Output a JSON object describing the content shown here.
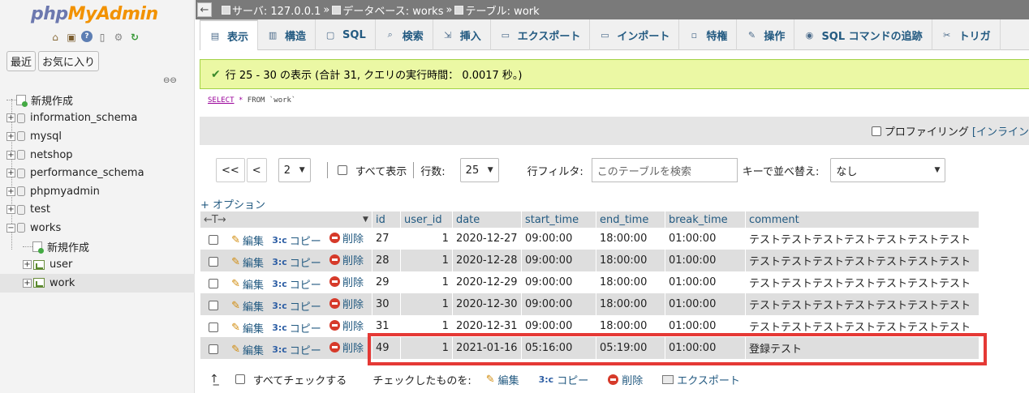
{
  "sidebar": {
    "logo_a": "php",
    "logo_b": "MyAdmin",
    "tab_recent": "最近",
    "tab_favorites": "お気に入り",
    "tree": [
      {
        "label": "新規作成",
        "kind": "new"
      },
      {
        "label": "information_schema",
        "kind": "db"
      },
      {
        "label": "mysql",
        "kind": "db"
      },
      {
        "label": "netshop",
        "kind": "db"
      },
      {
        "label": "performance_schema",
        "kind": "db"
      },
      {
        "label": "phpmyadmin",
        "kind": "db"
      },
      {
        "label": "test",
        "kind": "db"
      },
      {
        "label": "works",
        "kind": "db-open"
      },
      {
        "label": "新規作成",
        "kind": "new-child"
      },
      {
        "label": "user",
        "kind": "table"
      },
      {
        "label": "work",
        "kind": "table-selected"
      }
    ]
  },
  "breadcrumb": {
    "server": "サーバ: 127.0.0.1",
    "database": "データベース: works",
    "table": "テーブル: work",
    "sep": "»"
  },
  "tabs": [
    {
      "label": "表示",
      "icon": "browse-icon"
    },
    {
      "label": "構造",
      "icon": "structure-icon"
    },
    {
      "label": "SQL",
      "icon": "sql-icon"
    },
    {
      "label": "検索",
      "icon": "search-icon"
    },
    {
      "label": "挿入",
      "icon": "insert-icon"
    },
    {
      "label": "エクスポート",
      "icon": "export-icon"
    },
    {
      "label": "インポート",
      "icon": "import-icon"
    },
    {
      "label": "特権",
      "icon": "privileges-icon"
    },
    {
      "label": "操作",
      "icon": "wrench-icon"
    },
    {
      "label": "SQL コマンドの追跡",
      "icon": "eye-icon"
    },
    {
      "label": "トリガ",
      "icon": "trigger-icon"
    }
  ],
  "message": "行 25 - 30 の表示 (合計 31, クエリの実行時間： 0.0017 秒。)",
  "sql": {
    "select": "SELECT",
    "star": "*",
    "rest": "FROM `work`"
  },
  "profile": {
    "label": "プロファイリング",
    "inline": "[インライン"
  },
  "pager": {
    "first": "<<",
    "prev": "<",
    "page": "2",
    "show_all": "すべて表示",
    "rows_label": "行数:",
    "rows_value": "25",
    "filter_label": "行フィルタ:",
    "filter_placeholder": "このテーブルを検索",
    "sort_label": "キーで並べ替え:",
    "sort_value": "なし"
  },
  "options_label": "+ オプション",
  "table": {
    "arrows": "←T→",
    "headers": [
      "id",
      "user_id",
      "date",
      "start_time",
      "end_time",
      "break_time",
      "comment"
    ],
    "actions": {
      "edit": "編集",
      "copy": "コピー",
      "delete": "削除"
    },
    "rows": [
      [
        "27",
        "1",
        "2020-12-27",
        "09:00:00",
        "18:00:00",
        "01:00:00",
        "テストテストテストテストテストテストテスト"
      ],
      [
        "28",
        "1",
        "2020-12-28",
        "09:00:00",
        "18:00:00",
        "01:00:00",
        "テストテストテストテストテストテストテスト"
      ],
      [
        "29",
        "1",
        "2020-12-29",
        "09:00:00",
        "18:00:00",
        "01:00:00",
        "テストテストテストテストテストテストテスト"
      ],
      [
        "30",
        "1",
        "2020-12-30",
        "09:00:00",
        "18:00:00",
        "01:00:00",
        "テストテストテストテストテストテストテスト"
      ],
      [
        "31",
        "1",
        "2020-12-31",
        "09:00:00",
        "18:00:00",
        "01:00:00",
        "テストテストテストテストテストテストテスト"
      ],
      [
        "49",
        "1",
        "2021-01-16",
        "05:16:00",
        "05:19:00",
        "01:00:00",
        "登録テスト"
      ]
    ]
  },
  "bottom": {
    "check_all": "すべてチェックする",
    "with_selected": "チェックしたものを:",
    "edit": "編集",
    "copy": "コピー",
    "delete": "削除",
    "export": "エクスポート"
  },
  "colors": {
    "highlight": "#e53935",
    "link": "#235a81",
    "success_bg": "#ebf8a4"
  }
}
